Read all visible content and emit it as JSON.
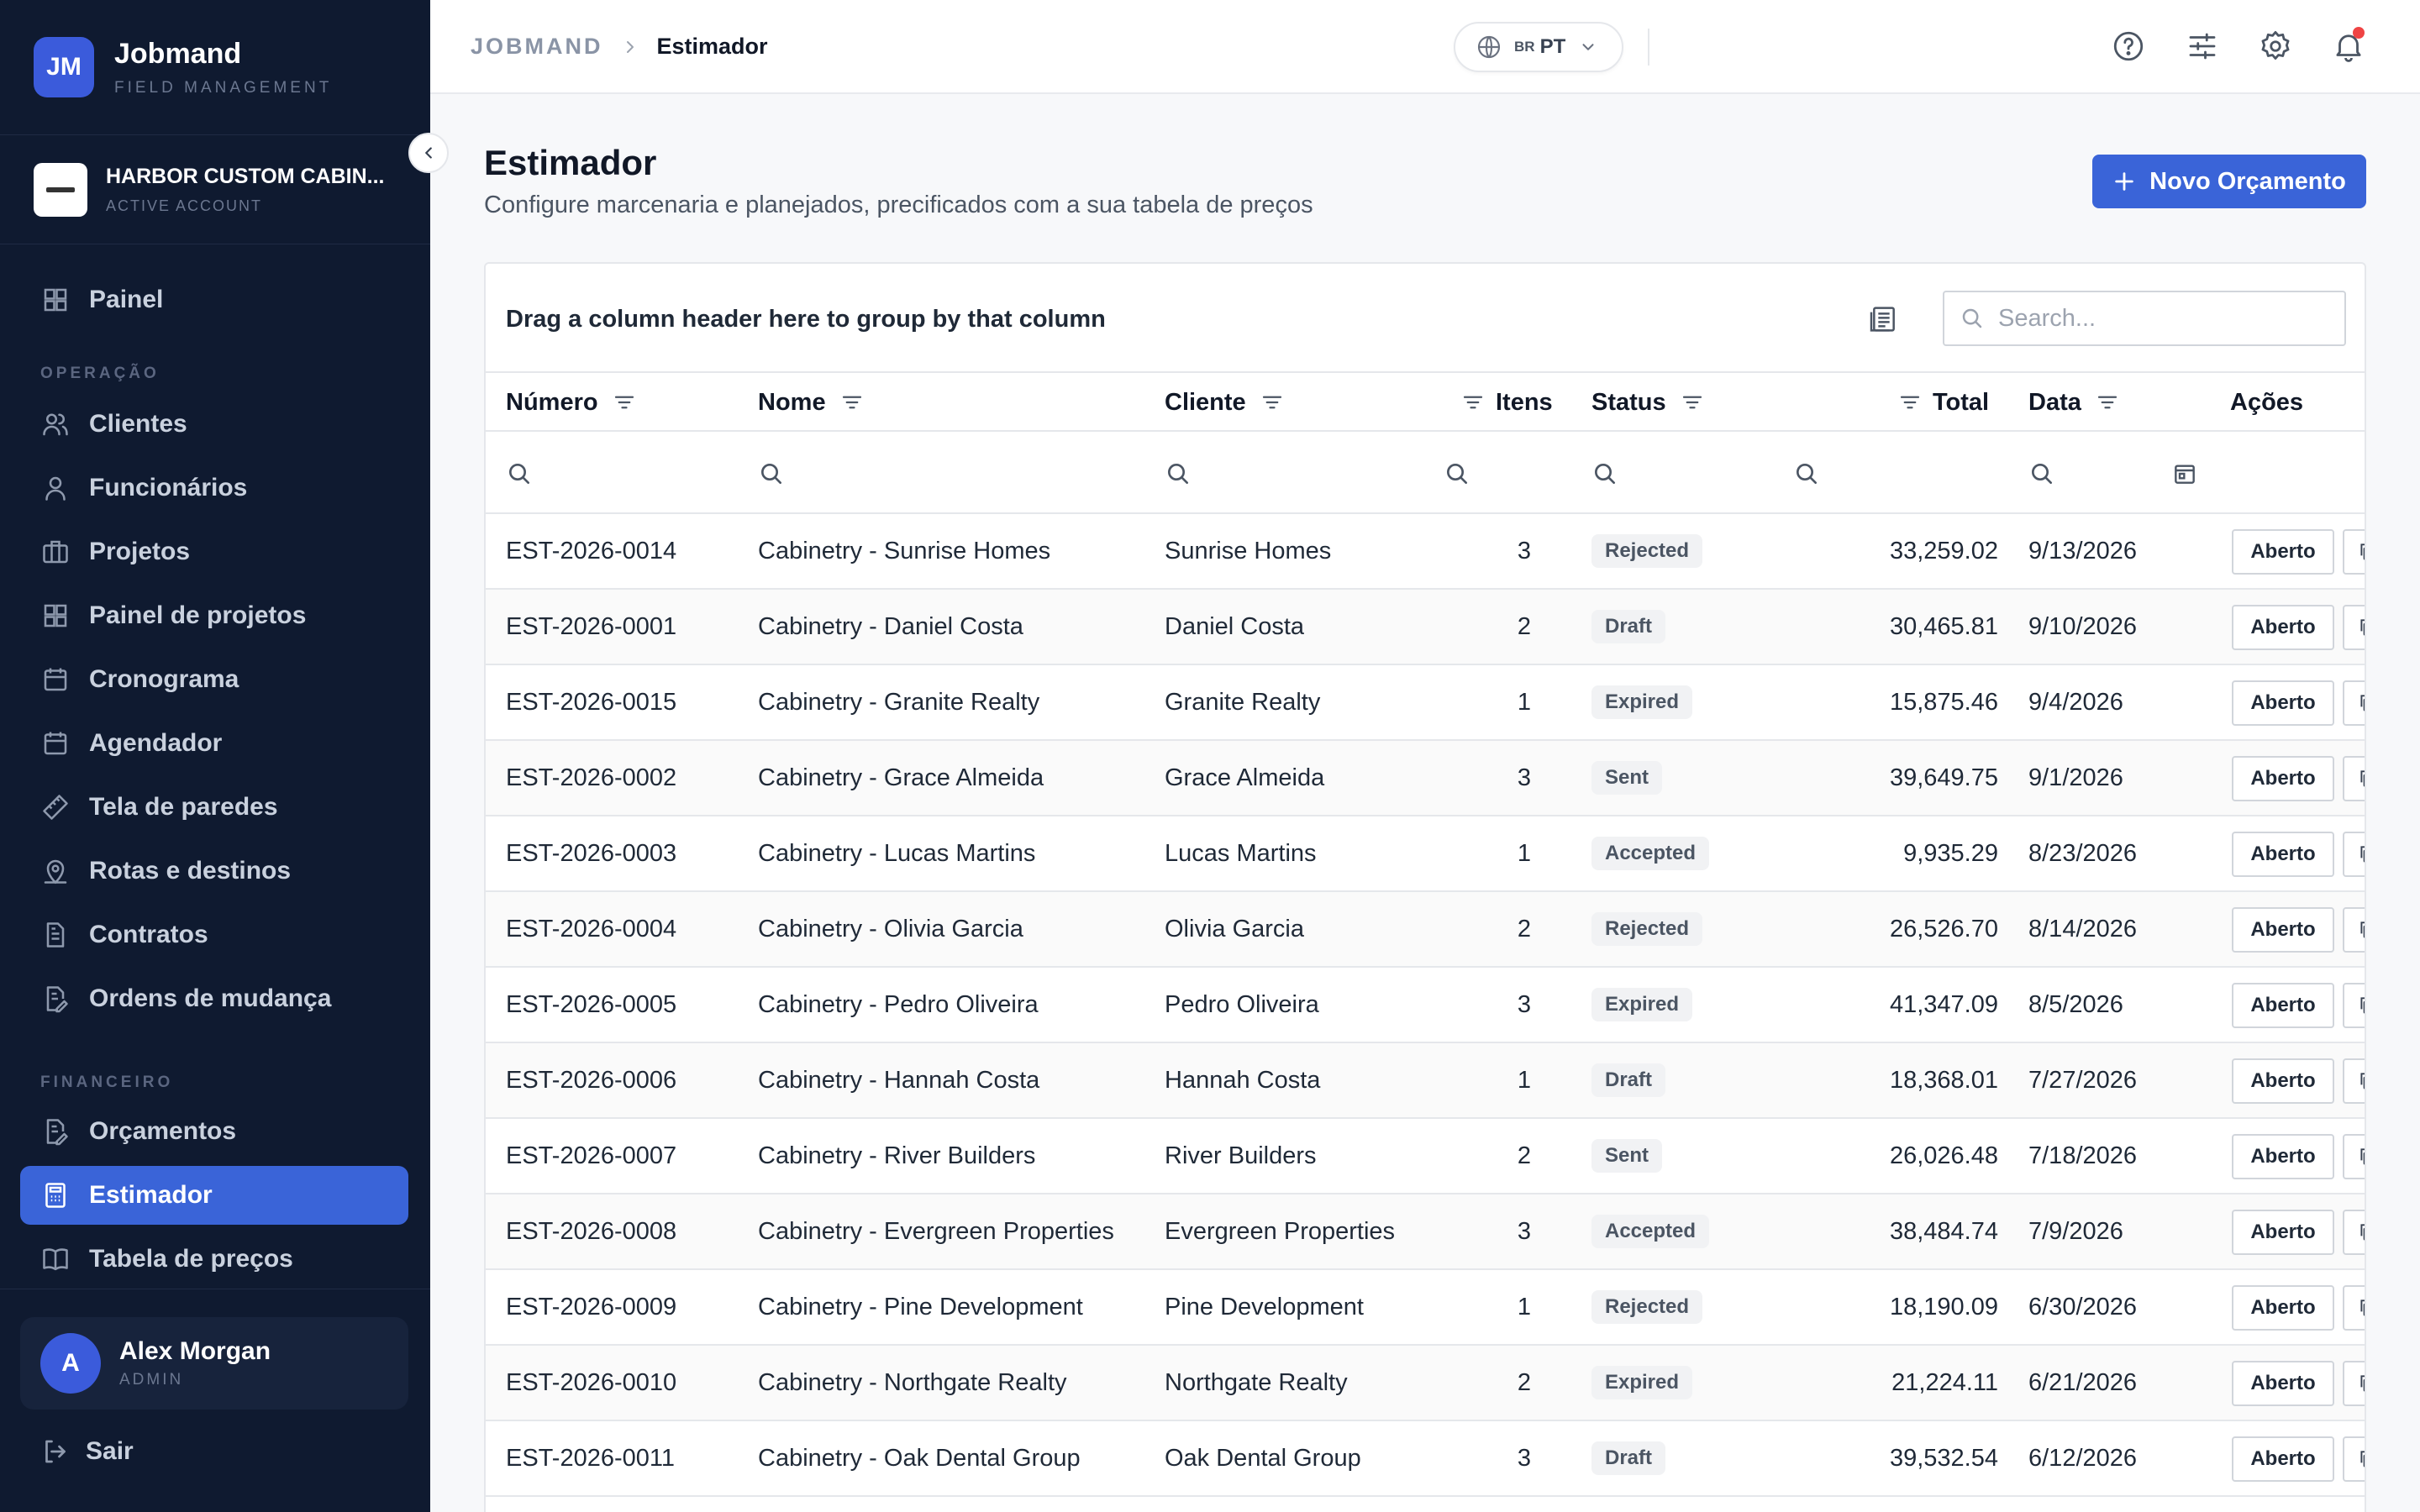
{
  "brand": {
    "initials": "JM",
    "name": "Jobmand",
    "subtitle": "FIELD MANAGEMENT"
  },
  "account": {
    "name": "HARBOR CUSTOM CABIN...",
    "subtitle": "ACTIVE ACCOUNT"
  },
  "sidebar": {
    "items": [
      {
        "label": "Painel",
        "icon": "grid-icon"
      },
      {
        "label": "Clientes",
        "icon": "users-icon"
      },
      {
        "label": "Funcionários",
        "icon": "user-icon"
      },
      {
        "label": "Projetos",
        "icon": "briefcase-icon"
      },
      {
        "label": "Painel de projetos",
        "icon": "grid-icon"
      },
      {
        "label": "Cronograma",
        "icon": "calendar-icon"
      },
      {
        "label": "Agendador",
        "icon": "calendar-icon"
      },
      {
        "label": "Tela de paredes",
        "icon": "ruler-icon"
      },
      {
        "label": "Rotas e destinos",
        "icon": "route-icon"
      },
      {
        "label": "Contratos",
        "icon": "document-icon"
      },
      {
        "label": "Ordens de mudança",
        "icon": "document-edit-icon"
      },
      {
        "label": "Orçamentos",
        "icon": "document-edit-icon"
      },
      {
        "label": "Estimador",
        "icon": "calculator-icon",
        "active": true
      },
      {
        "label": "Tabela de preços",
        "icon": "book-icon"
      }
    ],
    "sections": {
      "operacao": "OPERAÇÃO",
      "financeiro": "FINANCEIRO"
    }
  },
  "user": {
    "initial": "A",
    "name": "Alex Morgan",
    "role": "ADMIN"
  },
  "logout_label": "Sair",
  "breadcrumb": {
    "root": "JOBMAND",
    "current": "Estimador"
  },
  "language": {
    "flag": "BR",
    "code": "PT"
  },
  "header": {
    "title": "Estimador",
    "subtitle": "Configure marcenaria e planejados, precificados com a sua tabela de preços",
    "new_button": "Novo Orçamento"
  },
  "grid": {
    "group_hint": "Drag a column header here to group by that column",
    "search_placeholder": "Search...",
    "columns": [
      "Número",
      "Nome",
      "Cliente",
      "Itens",
      "Status",
      "Total",
      "Data",
      "Ações"
    ],
    "action_label": "Aberto",
    "rows": [
      {
        "numero": "EST-2026-0014",
        "nome": "Cabinetry - Sunrise Homes",
        "cliente": "Sunrise Homes",
        "itens": "3",
        "status": "Rejected",
        "total": "33,259.02",
        "data": "9/13/2026"
      },
      {
        "numero": "EST-2026-0001",
        "nome": "Cabinetry - Daniel Costa",
        "cliente": "Daniel Costa",
        "itens": "2",
        "status": "Draft",
        "total": "30,465.81",
        "data": "9/10/2026"
      },
      {
        "numero": "EST-2026-0015",
        "nome": "Cabinetry - Granite Realty",
        "cliente": "Granite Realty",
        "itens": "1",
        "status": "Expired",
        "total": "15,875.46",
        "data": "9/4/2026"
      },
      {
        "numero": "EST-2026-0002",
        "nome": "Cabinetry - Grace Almeida",
        "cliente": "Grace Almeida",
        "itens": "3",
        "status": "Sent",
        "total": "39,649.75",
        "data": "9/1/2026"
      },
      {
        "numero": "EST-2026-0003",
        "nome": "Cabinetry - Lucas Martins",
        "cliente": "Lucas Martins",
        "itens": "1",
        "status": "Accepted",
        "total": "9,935.29",
        "data": "8/23/2026"
      },
      {
        "numero": "EST-2026-0004",
        "nome": "Cabinetry - Olivia Garcia",
        "cliente": "Olivia Garcia",
        "itens": "2",
        "status": "Rejected",
        "total": "26,526.70",
        "data": "8/14/2026"
      },
      {
        "numero": "EST-2026-0005",
        "nome": "Cabinetry - Pedro Oliveira",
        "cliente": "Pedro Oliveira",
        "itens": "3",
        "status": "Expired",
        "total": "41,347.09",
        "data": "8/5/2026"
      },
      {
        "numero": "EST-2026-0006",
        "nome": "Cabinetry - Hannah Costa",
        "cliente": "Hannah Costa",
        "itens": "1",
        "status": "Draft",
        "total": "18,368.01",
        "data": "7/27/2026"
      },
      {
        "numero": "EST-2026-0007",
        "nome": "Cabinetry - River Builders",
        "cliente": "River Builders",
        "itens": "2",
        "status": "Sent",
        "total": "26,026.48",
        "data": "7/18/2026"
      },
      {
        "numero": "EST-2026-0008",
        "nome": "Cabinetry - Evergreen Properties",
        "cliente": "Evergreen Properties",
        "itens": "3",
        "status": "Accepted",
        "total": "38,484.74",
        "data": "7/9/2026"
      },
      {
        "numero": "EST-2026-0009",
        "nome": "Cabinetry - Pine Development",
        "cliente": "Pine Development",
        "itens": "1",
        "status": "Rejected",
        "total": "18,190.09",
        "data": "6/30/2026"
      },
      {
        "numero": "EST-2026-0010",
        "nome": "Cabinetry - Northgate Realty",
        "cliente": "Northgate Realty",
        "itens": "2",
        "status": "Expired",
        "total": "21,224.11",
        "data": "6/21/2026"
      },
      {
        "numero": "EST-2026-0011",
        "nome": "Cabinetry - Oak Dental Group",
        "cliente": "Oak Dental Group",
        "itens": "3",
        "status": "Draft",
        "total": "39,532.54",
        "data": "6/12/2026"
      }
    ]
  },
  "colors": {
    "sidebar_bg": "#0f1a30",
    "accent": "#3a64d8",
    "notification": "#ef4444"
  }
}
